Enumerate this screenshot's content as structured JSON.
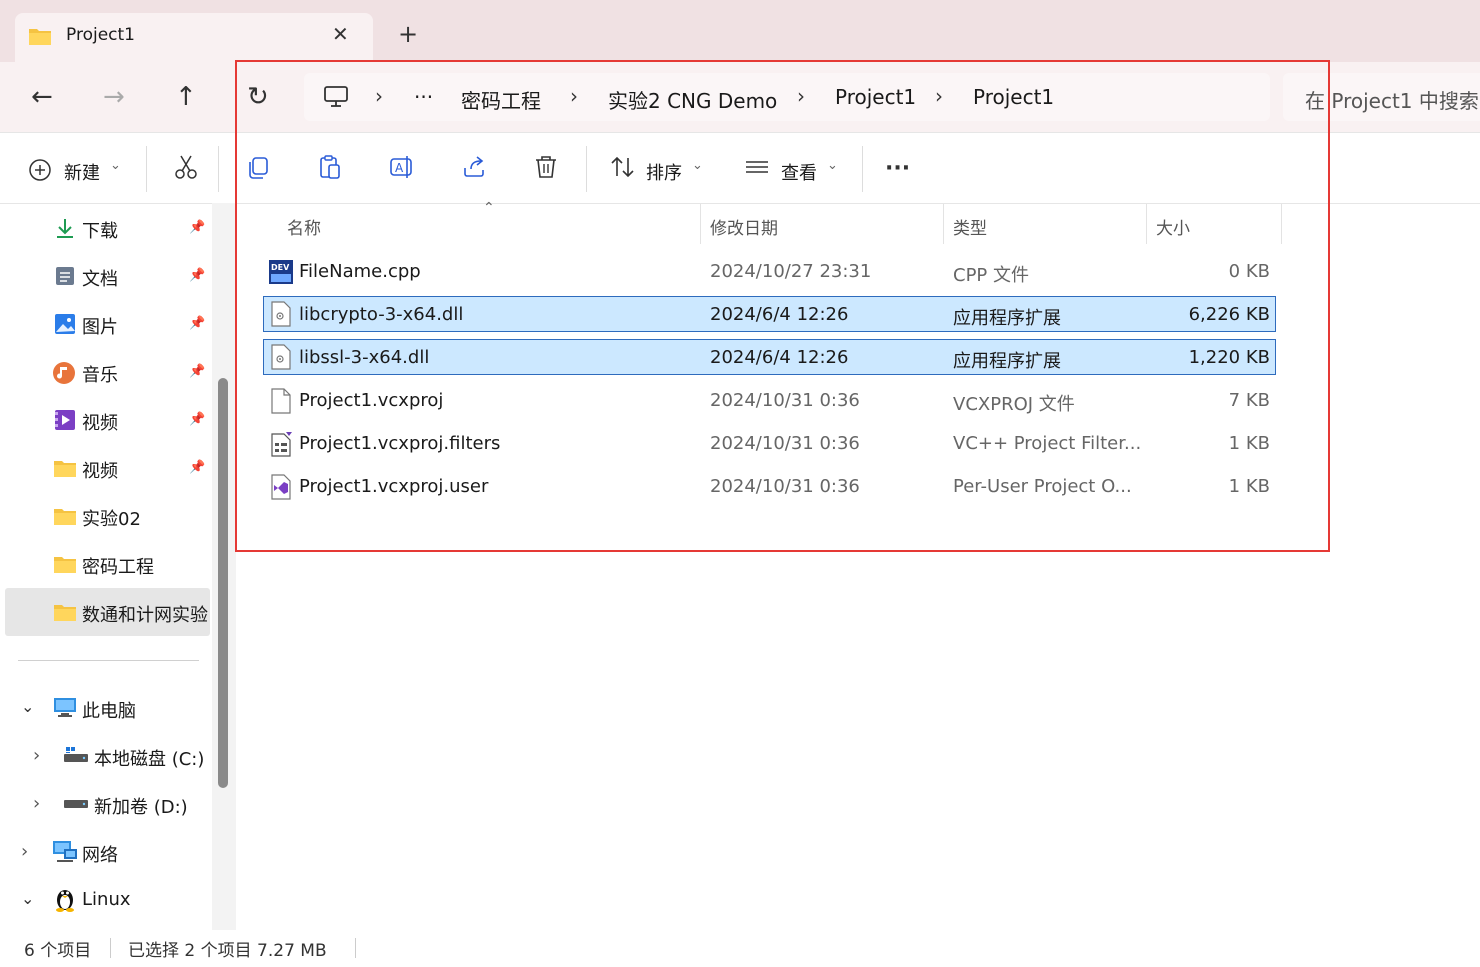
{
  "tab": {
    "title": "Project1",
    "close": "✕",
    "new_tab": "+"
  },
  "nav": {
    "back": "←",
    "forward": "→",
    "up": "↑",
    "refresh": "↻"
  },
  "breadcrumb": {
    "overflow": "···",
    "items": [
      "密码工程",
      "实验2 CNG Demo",
      "Project1",
      "Project1"
    ],
    "separator": "›"
  },
  "search": {
    "placeholder": "在 Project1 中搜索"
  },
  "toolbar": {
    "new_label": "新建",
    "sort_label": "排序",
    "view_label": "查看",
    "more": "···",
    "dropdown": "⌄"
  },
  "sidebar": {
    "quick_access": [
      {
        "label": "下载",
        "icon": "download-icon",
        "pinned": true
      },
      {
        "label": "文档",
        "icon": "document-icon",
        "pinned": true
      },
      {
        "label": "图片",
        "icon": "pictures-icon",
        "pinned": true
      },
      {
        "label": "音乐",
        "icon": "music-icon",
        "pinned": true
      },
      {
        "label": "视频",
        "icon": "video-icon",
        "pinned": true
      },
      {
        "label": "视频",
        "icon": "folder-icon",
        "pinned": true
      },
      {
        "label": "实验02",
        "icon": "folder-icon",
        "pinned": false
      },
      {
        "label": "密码工程",
        "icon": "folder-icon",
        "pinned": false
      },
      {
        "label": "数通和计网实验",
        "icon": "folder-icon",
        "pinned": false
      }
    ],
    "this_pc": "此电脑",
    "drives": [
      "本地磁盘 (C:)",
      "新加卷 (D:)"
    ],
    "network": "网络",
    "linux": "Linux"
  },
  "columns": {
    "name": "名称",
    "date": "修改日期",
    "type": "类型",
    "size": "大小"
  },
  "files": [
    {
      "name": "FileName.cpp",
      "date": "2024/10/27 23:31",
      "type": "CPP 文件",
      "size": "0 KB",
      "icon": "devcpp-file-icon",
      "selected": false
    },
    {
      "name": "libcrypto-3-x64.dll",
      "date": "2024/6/4 12:26",
      "type": "应用程序扩展",
      "size": "6,226 KB",
      "icon": "dll-file-icon",
      "selected": true
    },
    {
      "name": "libssl-3-x64.dll",
      "date": "2024/6/4 12:26",
      "type": "应用程序扩展",
      "size": "1,220 KB",
      "icon": "dll-file-icon",
      "selected": true
    },
    {
      "name": "Project1.vcxproj",
      "date": "2024/10/31 0:36",
      "type": "VCXPROJ 文件",
      "size": "7 KB",
      "icon": "blank-file-icon",
      "selected": false
    },
    {
      "name": "Project1.vcxproj.filters",
      "date": "2024/10/31 0:36",
      "type": "VC++ Project Filter...",
      "size": "1 KB",
      "icon": "filters-file-icon",
      "selected": false
    },
    {
      "name": "Project1.vcxproj.user",
      "date": "2024/10/31 0:36",
      "type": "Per-User Project O...",
      "size": "1 KB",
      "icon": "vs-user-file-icon",
      "selected": false
    }
  ],
  "status": {
    "count": "6 个项目",
    "selection": "已选择 2 个项目  7.27 MB"
  },
  "colors": {
    "accent": "#0067c0",
    "selection": "#cce8ff",
    "highlight_box": "#e53935",
    "tab_strip": "#f0e1e3"
  }
}
